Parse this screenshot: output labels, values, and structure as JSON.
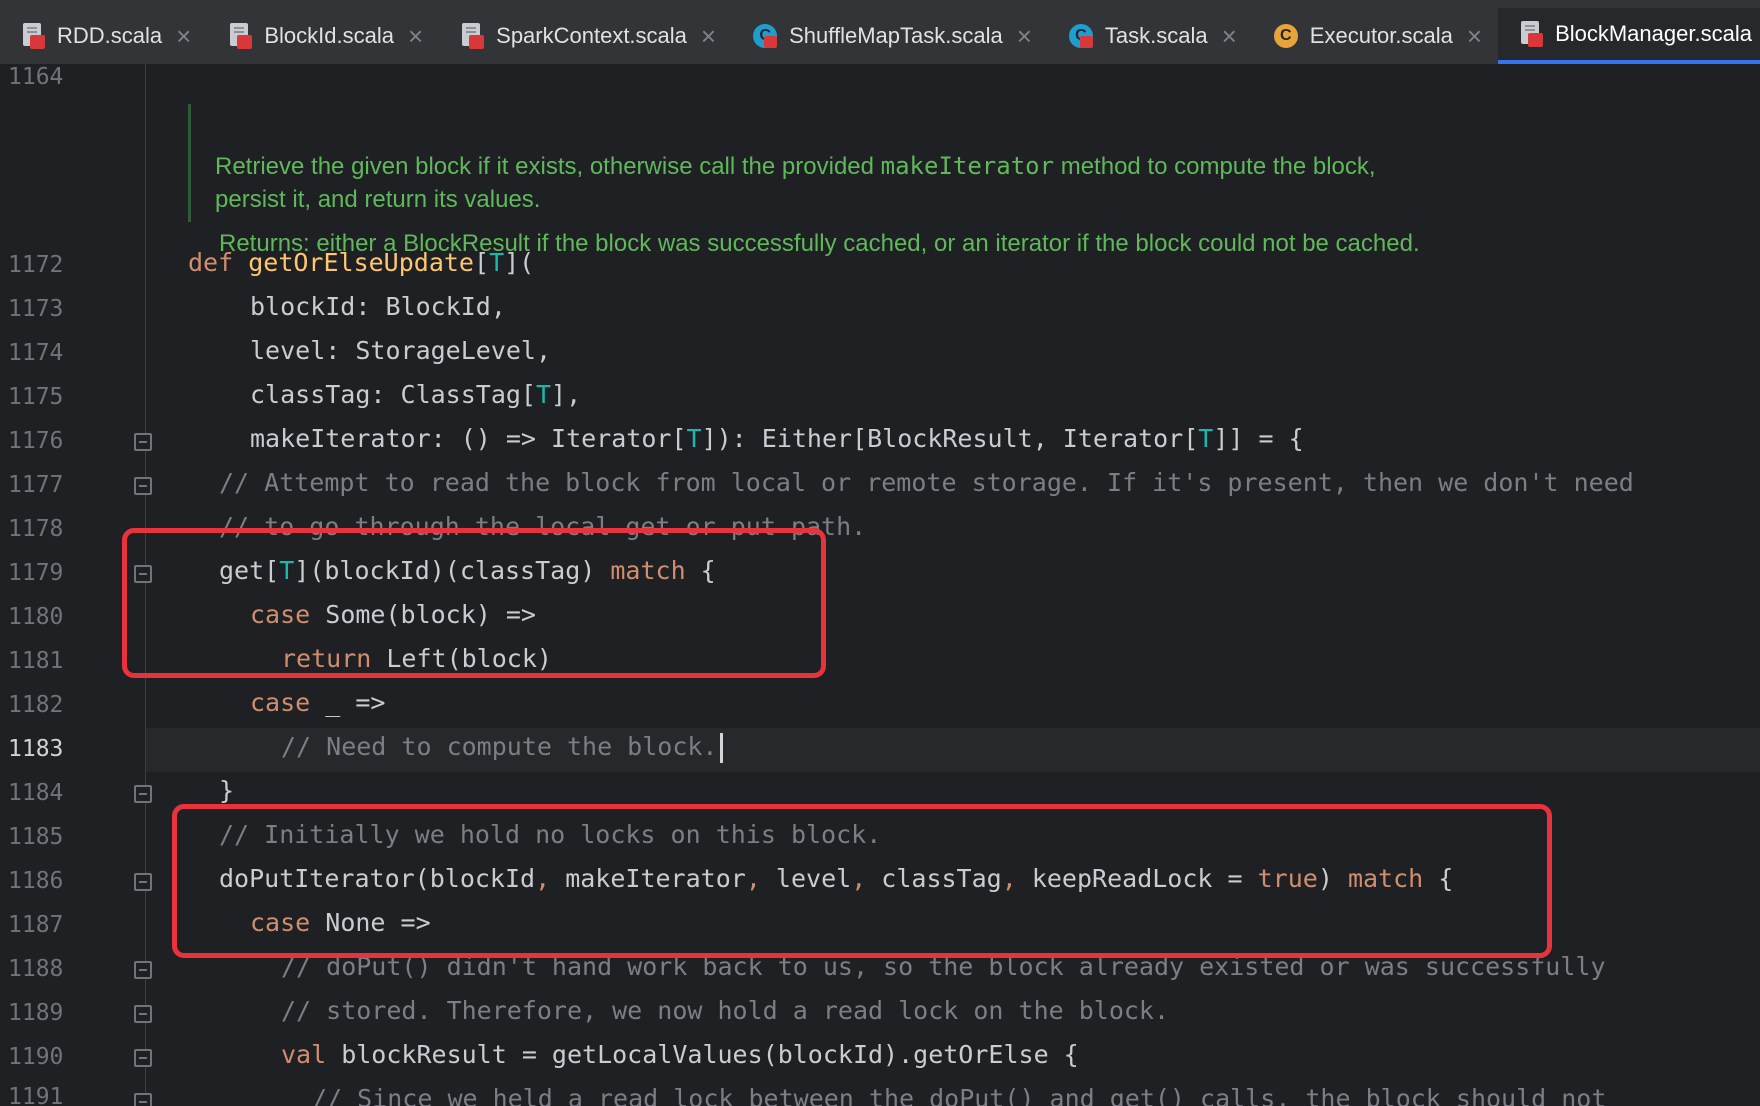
{
  "tabs": [
    {
      "label": "RDD.scala",
      "icon": "scala-file-icon",
      "active": false
    },
    {
      "label": "BlockId.scala",
      "icon": "scala-file-icon",
      "active": false
    },
    {
      "label": "SparkContext.scala",
      "icon": "scala-file-icon",
      "active": false
    },
    {
      "label": "ShuffleMapTask.scala",
      "icon": "scala-class-icon",
      "active": false
    },
    {
      "label": "Task.scala",
      "icon": "scala-class-icon",
      "active": false
    },
    {
      "label": "Executor.scala",
      "icon": "scala-class-icon",
      "active": false
    },
    {
      "label": "BlockManager.scala",
      "icon": "scala-file-icon",
      "active": true
    }
  ],
  "close_glyph": "×",
  "doc": {
    "line1_before": "Retrieve the given block if it exists, otherwise call the provided ",
    "line1_code": "makeIterator",
    "line1_after": " method to compute the block,",
    "line2": "persist it, and return its values.",
    "returns_label": "Returns:",
    "returns_text": "either a BlockResult if the block was successfully cached, or an iterator if the block could not be cached."
  },
  "line_numbers": {
    "first": "1164",
    "rest": [
      "1172",
      "1173",
      "1174",
      "1175",
      "1176",
      "1177",
      "1178",
      "1179",
      "1180",
      "1181",
      "1182",
      "1183",
      "1184",
      "1185",
      "1186",
      "1187",
      "1188",
      "1189",
      "1190",
      "1191"
    ],
    "current": "1183"
  },
  "code": {
    "l1172": {
      "kw": "def",
      "name": "getOrElseUpdate",
      "rest_a": "[",
      "tp": "T",
      "rest_b": "]("
    },
    "l1173": "blockId: BlockId,",
    "l1174": "level: StorageLevel,",
    "l1175": {
      "a": "classTag: ClassTag[",
      "tp": "T",
      "b": "],"
    },
    "l1176": {
      "a": "makeIterator: () => Iterator[",
      "tp": "T",
      "b": "]): Either[BlockResult, Iterator[",
      "tp2": "T",
      "c": "]] = {"
    },
    "l1177": "// Attempt to read the block from local or remote storage. If it's present, then we don't need",
    "l1178": "// to go through the local get or put path.",
    "l1179": {
      "a": "get[",
      "tp": "T",
      "b": "](blockId)(classTag) ",
      "kw": "match",
      "c": " {"
    },
    "l1180": {
      "kw": "case",
      "rest": " Some(block) =>"
    },
    "l1181": {
      "kw": "return",
      "rest": " Left(block)"
    },
    "l1182": {
      "kw": "case",
      "rest": " _ =>"
    },
    "l1183": "// Need to compute the block.",
    "l1184": "}",
    "l1185": "// Initially we hold no locks on this block.",
    "l1186": {
      "a": "doPutIterator(blockId",
      "c1": ",",
      "b": " makeIterator",
      "c2": ",",
      "c": " level",
      "c3": ",",
      "d": " classTag",
      "c4": ",",
      "e": " keepReadLock = ",
      "val": "true",
      "f": ") ",
      "kw": "match",
      "g": " {"
    },
    "l1187": {
      "kw": "case",
      "rest": " None =>"
    },
    "l1188": "// doPut() didn't hand work back to us, so the block already existed or was successfully",
    "l1189": "// stored. Therefore, we now hold a read lock on the block.",
    "l1190": {
      "kw": "val",
      "rest": " blockResult = getLocalValues(blockId).getOrElse {"
    },
    "l1191": "// Since we held a read lock between the doPut() and get() calls, the block should not"
  }
}
